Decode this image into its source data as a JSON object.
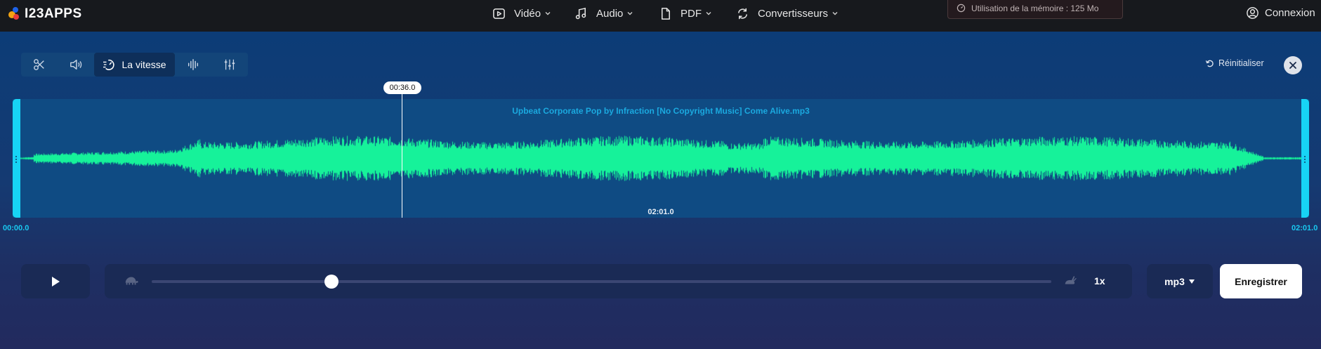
{
  "header": {
    "logo_text": "I23APPS",
    "nav": [
      {
        "label": "Vidéo",
        "icon": "video-icon"
      },
      {
        "label": "Audio",
        "icon": "music-note-icon"
      },
      {
        "label": "PDF",
        "icon": "document-icon"
      },
      {
        "label": "Convertisseurs",
        "icon": "convert-icon"
      }
    ],
    "memory_label": "Utilisation de la mémoire : 125 Mo",
    "login_label": "Connexion"
  },
  "toolbar": {
    "tools": [
      {
        "name": "cut",
        "icon": "scissors-icon"
      },
      {
        "name": "volume",
        "icon": "speaker-icon"
      },
      {
        "name": "speed",
        "icon": "speed-icon",
        "label": "La vitesse",
        "active": true
      },
      {
        "name": "equalizer",
        "icon": "waveform-icon"
      },
      {
        "name": "mixer",
        "icon": "sliders-icon"
      }
    ],
    "reset_label": "Réinitialiser"
  },
  "editor": {
    "file_name": "Upbeat Corporate Pop by Infraction [No Copyright Music] Come Alive.mp3",
    "cursor_time": "00:36.0",
    "duration": "02:01.0",
    "start_time": "00:00.0",
    "end_time": "02:01.0",
    "waveform_color": "#16f29a",
    "handle_color": "#17d4f5"
  },
  "controls": {
    "speed_value": "1x",
    "speed_position": 0.2,
    "format": "mp3",
    "save_label": "Enregistrer"
  }
}
